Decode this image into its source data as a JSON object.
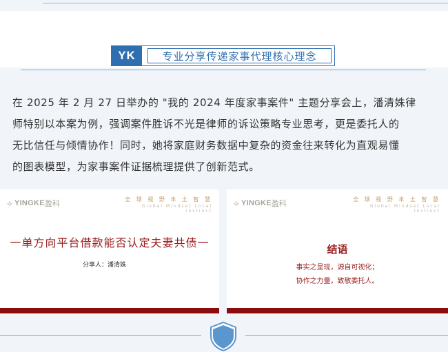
{
  "header": {
    "badge": "YK",
    "title": "专业分享传递家事代理核心理念"
  },
  "article": {
    "lines": [
      "在 2025 年 2 月 27 日举办的 \"我的 2024 年度家事案件\" 主题分享会上，潘清姝律",
      "师特别以本案为例，强调案件胜诉不光是律师的诉讼策略专业思考，更是委托人的",
      "无比信任与倾情协作！同时，她将家庭财务数据中复杂的资金往来转化为直观易懂",
      "的图表模型，为家事案件证据梳理提供了创新范式。"
    ]
  },
  "slides": {
    "logo": {
      "mark": "⟡",
      "name": "YINGKE",
      "cn": "盈科"
    },
    "tagline_cn": "全 球 视 野   本 土 智 慧",
    "tagline_en": "Global  Mindset  Local  Instinct",
    "left": {
      "title": "一单方向平台借款能否认定夫妻共债一",
      "sharer": "分享人：潘清姝"
    },
    "right": {
      "title": "结语",
      "line1": "事实之呈现，源自可视化；",
      "line2": "协作之力量，致敬委托人。"
    }
  },
  "colors": {
    "accent_blue": "#2f6fb0",
    "slide_red": "#8b0c0c",
    "shield_blue": "#5b97cf"
  }
}
